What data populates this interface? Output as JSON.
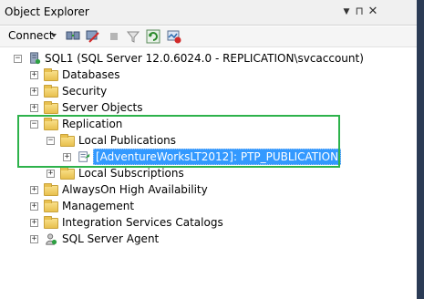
{
  "window": {
    "title": "Object Explorer"
  },
  "toolbar": {
    "connect_label": "Connect"
  },
  "tree": {
    "server": "SQL1 (SQL Server 12.0.6024.0 - REPLICATION\\svcaccount)",
    "databases": "Databases",
    "security": "Security",
    "server_objects": "Server Objects",
    "replication": "Replication",
    "local_publications": "Local Publications",
    "publication": "[AdventureWorksLT2012]: PTP_PUBLICATION",
    "local_subscriptions": "Local Subscriptions",
    "alwayson": "AlwaysOn High Availability",
    "management": "Management",
    "integration_services": "Integration Services Catalogs",
    "sql_agent": "SQL Server Agent"
  },
  "colors": {
    "highlight": "#2db24b",
    "selection": "#3399ff"
  }
}
